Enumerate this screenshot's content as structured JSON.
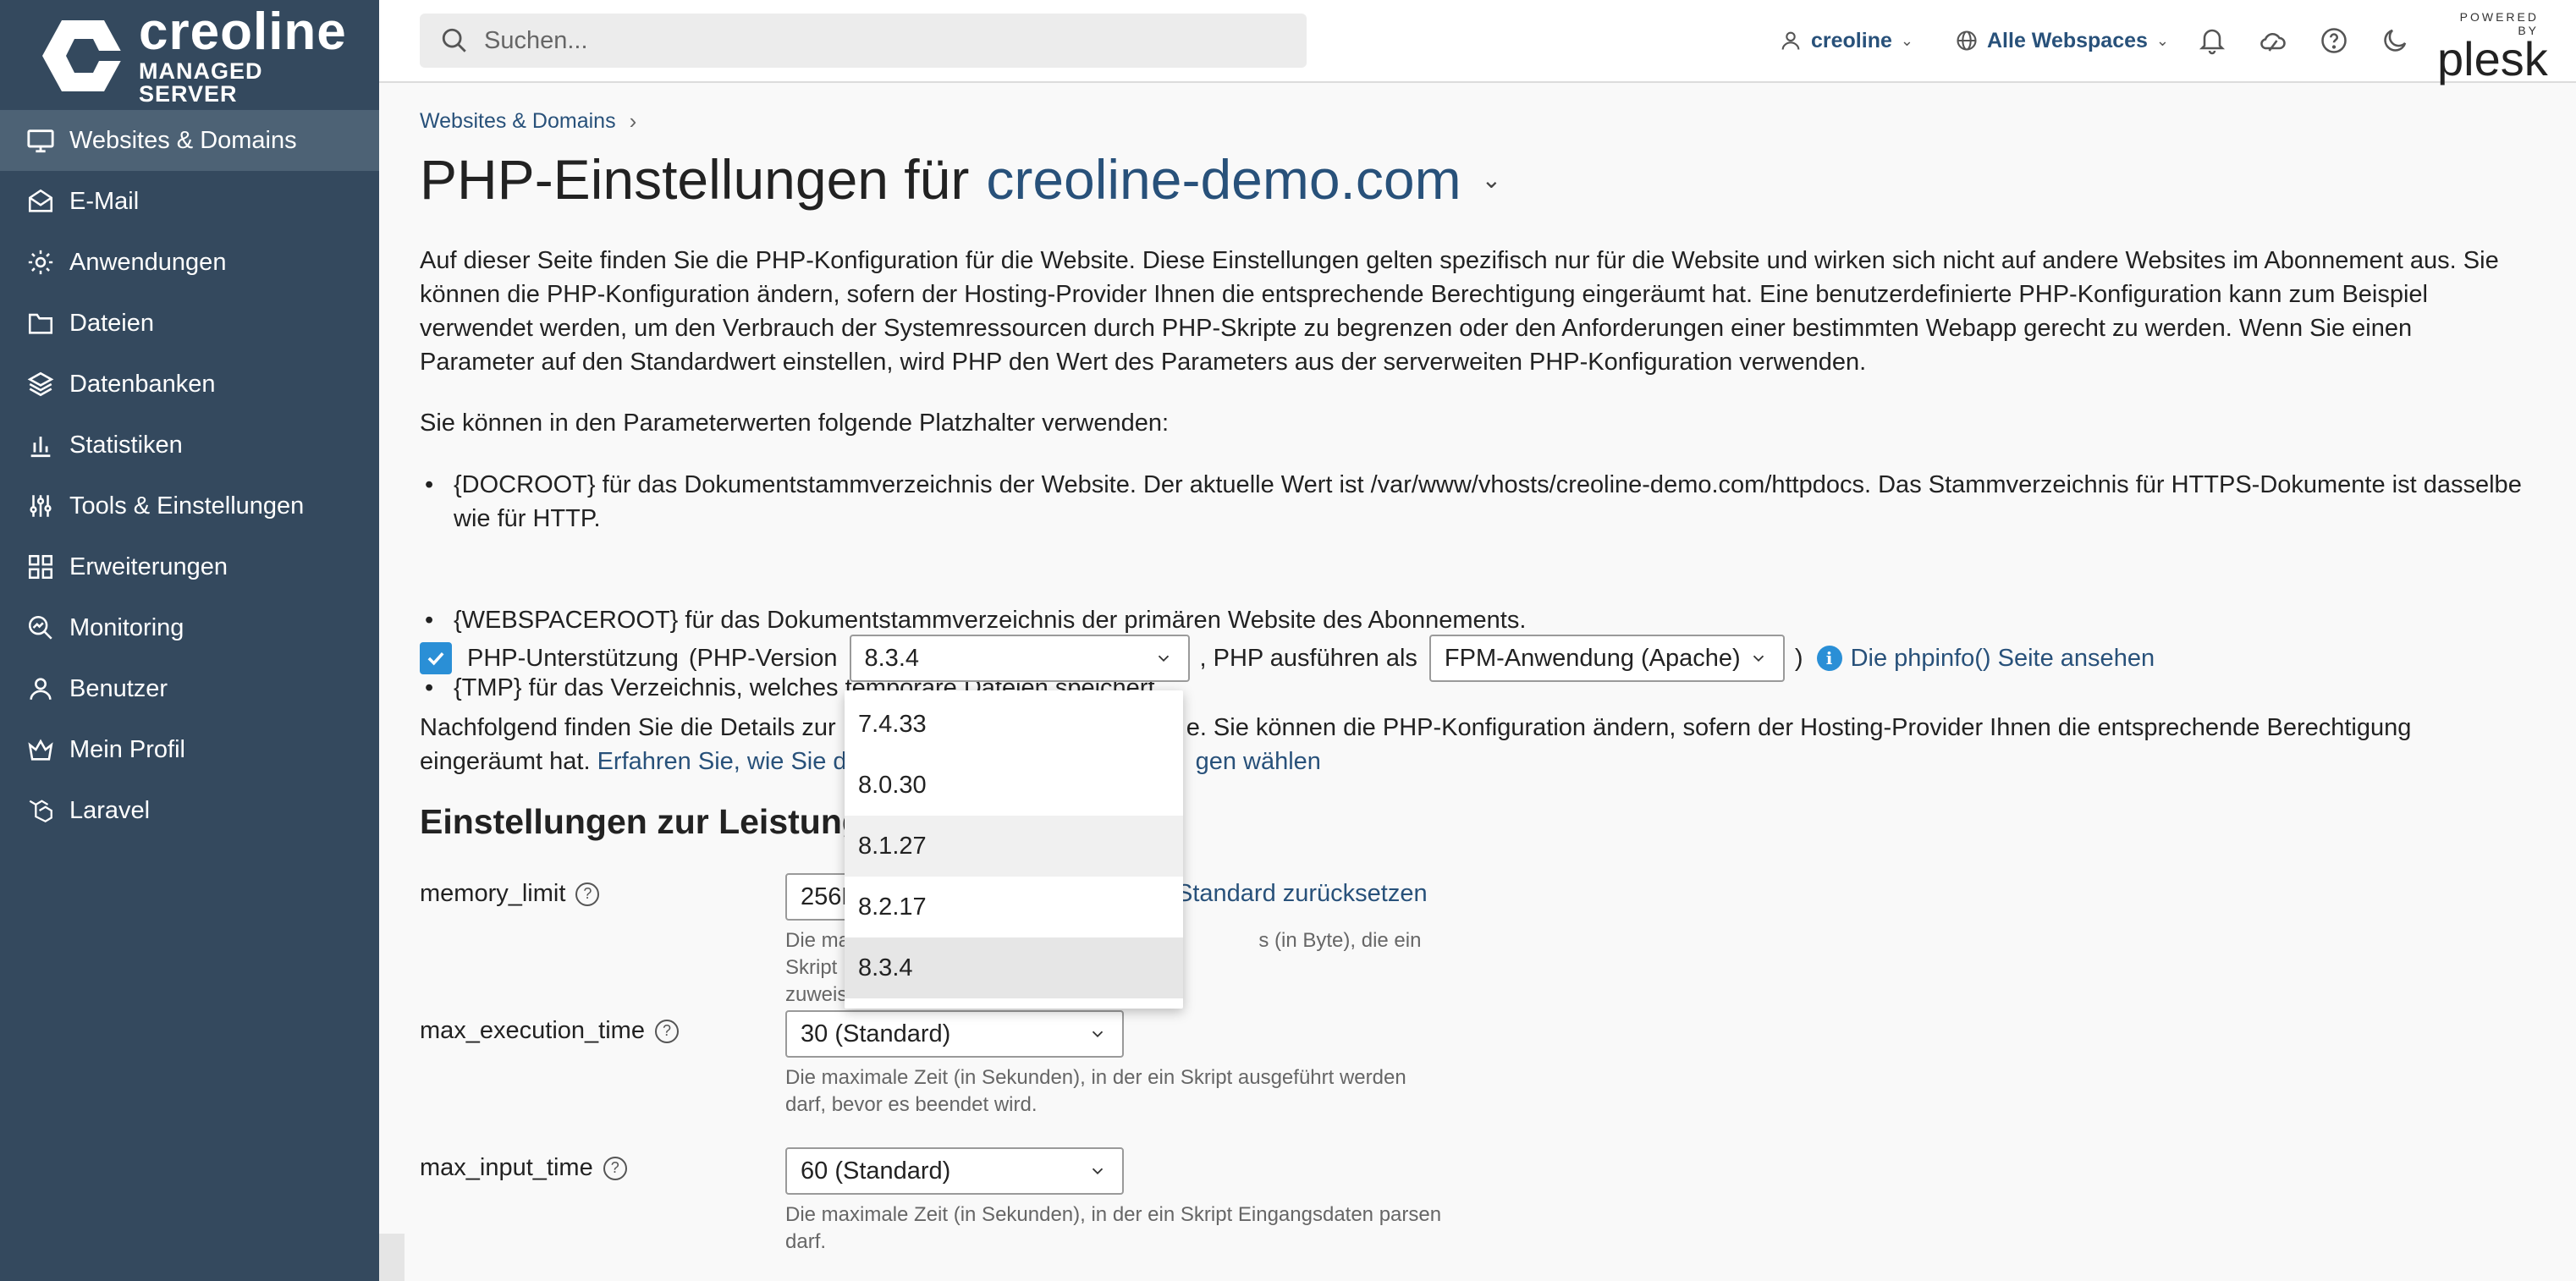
{
  "logo": {
    "name": "creoline",
    "subtitle": "MANAGED SERVER"
  },
  "sidebar": {
    "items": [
      {
        "label": "Websites & Domains",
        "icon": "monitor-icon",
        "active": true
      },
      {
        "label": "E-Mail",
        "icon": "mail-icon"
      },
      {
        "label": "Anwendungen",
        "icon": "gear-icon"
      },
      {
        "label": "Dateien",
        "icon": "folder-icon"
      },
      {
        "label": "Datenbanken",
        "icon": "layers-icon"
      },
      {
        "label": "Statistiken",
        "icon": "bar-chart-icon"
      },
      {
        "label": "Tools & Einstellungen",
        "icon": "sliders-icon"
      },
      {
        "label": "Erweiterungen",
        "icon": "grid-icon"
      },
      {
        "label": "Monitoring",
        "icon": "magnifier-chart-icon"
      },
      {
        "label": "Benutzer",
        "icon": "user-icon"
      },
      {
        "label": "Mein Profil",
        "icon": "profile-icon"
      },
      {
        "label": "Laravel",
        "icon": "laravel-icon"
      }
    ]
  },
  "header": {
    "search_placeholder": "Suchen...",
    "user": "creoline",
    "webspaces": "Alle Webspaces",
    "plesk_powered": "POWERED BY",
    "plesk_name": "plesk"
  },
  "breadcrumb": {
    "item": "Websites & Domains"
  },
  "page": {
    "title_prefix": "PHP-Einstellungen für",
    "title_domain": "creoline-demo.com",
    "intro": "Auf dieser Seite finden Sie die PHP-Konfiguration für die Website. Diese Einstellungen gelten spezifisch nur für die Website und wirken sich nicht auf andere Websites im Abonnement aus. Sie können die PHP-Konfiguration ändern, sofern der Hosting-Provider Ihnen die entsprechende Berechtigung eingeräumt hat. Eine benutzerdefinierte PHP-Konfiguration kann zum Beispiel verwendet werden, um den Verbrauch der Systemressourcen durch PHP-Skripte zu begrenzen oder den Anforderungen einer bestimmten Webapp gerecht zu werden. Wenn Sie einen Parameter auf den Standardwert einstellen, wird PHP den Wert des Parameters aus der serverweiten PHP-Konfiguration verwenden.",
    "placeholders_intro": "Sie können in den Parameterwerten folgende Platzhalter verwenden:",
    "bullets": [
      "{DOCROOT} für das Dokumentstammverzeichnis der Website. Der aktuelle Wert ist /var/www/vhosts/creoline-demo.com/httpdocs. Das Stammverzeichnis für HTTPS-Dokumente ist dasselbe wie für HTTP.",
      "{WEBSPACEROOT} für das Dokumentstammverzeichnis der primären Website des Abonnements.",
      "{TMP} für das Verzeichnis, welches temporäre Dateien speichert."
    ],
    "php_support_label": "PHP-Unterstützung",
    "php_version_label": "(PHP-Version",
    "php_version_value": "8.3.4",
    "php_run_as_label": ", PHP ausführen als",
    "php_run_as_value": "FPM-Anwendung (Apache)",
    "close_paren": ")",
    "phpinfo_link": "Die phpinfo() Seite ansehen",
    "details_text_a": "Nachfolgend finden Sie die Details zur",
    "details_text_b": "e. Sie können die PHP-Konfiguration ändern, sofern der Hosting-Provider Ihnen die entsprechende Berechtigung",
    "details_text_c": "eingeräumt hat.",
    "details_link_a": "Erfahren Sie, wie Sie d",
    "details_link_b": "gen wählen",
    "section_title": "Einstellungen zur Leistung",
    "reset_link": "Standard zurücksetzen"
  },
  "settings": [
    {
      "name": "memory_limit",
      "value": "256M",
      "hint_a": "Die maxi",
      "hint_b": "s (in Byte), die ein Skript",
      "hint_c": "zuweis"
    },
    {
      "name": "max_execution_time",
      "value": "30 (Standard)",
      "hint": "Die maximale Zeit (in Sekunden), in der ein Skript ausgeführt werden darf, bevor es beendet wird."
    },
    {
      "name": "max_input_time",
      "value": "60 (Standard)",
      "hint": "Die maximale Zeit (in Sekunden), in der ein Skript Eingangsdaten parsen darf."
    }
  ],
  "php_versions": [
    "7.4.33",
    "8.0.30",
    "8.1.27",
    "8.2.17",
    "8.3.4"
  ],
  "colors": {
    "sidebar": "#34495e",
    "sidebar_active": "#4d6275",
    "link": "#28517a",
    "checkbox": "#2a8fd6"
  }
}
